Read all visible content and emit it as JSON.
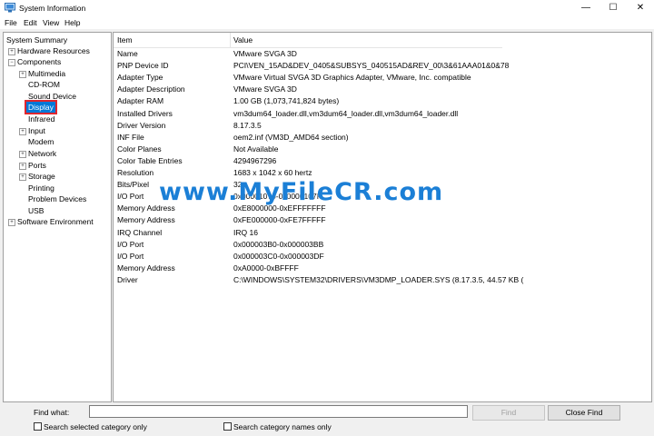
{
  "window": {
    "title": "System Information",
    "minimize_glyph": "—",
    "maximize_glyph": "☐",
    "close_glyph": "✕"
  },
  "menu": [
    "File",
    "Edit",
    "View",
    "Help"
  ],
  "tree": {
    "root": "System Summary",
    "hardware": "Hardware Resources",
    "components": "Components",
    "children": {
      "multimedia": "Multimedia",
      "cdrom": "CD-ROM",
      "sound": "Sound Device",
      "display": "Display",
      "infrared": "Infrared",
      "input": "Input",
      "modem": "Modem",
      "network": "Network",
      "ports": "Ports",
      "storage": "Storage",
      "printing": "Printing",
      "problem": "Problem Devices",
      "usb": "USB"
    },
    "software": "Software Environment",
    "expand_glyph": "+",
    "collapse_glyph": "−"
  },
  "table": {
    "col_item": "Item",
    "col_value": "Value",
    "rows": [
      {
        "item": "Name",
        "value": "VMware SVGA 3D"
      },
      {
        "item": "PNP Device ID",
        "value": "PCI\\VEN_15AD&DEV_0405&SUBSYS_040515AD&REV_00\\3&61AAA01&0&78"
      },
      {
        "item": "Adapter Type",
        "value": "VMware Virtual SVGA 3D Graphics Adapter, VMware, Inc. compatible"
      },
      {
        "item": "Adapter Description",
        "value": "VMware SVGA 3D"
      },
      {
        "item": "Adapter RAM",
        "value": "1.00 GB (1,073,741,824 bytes)"
      },
      {
        "item": "Installed Drivers",
        "value": "vm3dum64_loader.dll,vm3dum64_loader.dll,vm3dum64_loader.dll"
      },
      {
        "item": "Driver Version",
        "value": "8.17.3.5"
      },
      {
        "item": "INF File",
        "value": "oem2.inf (VM3D_AMD64 section)"
      },
      {
        "item": "Color Planes",
        "value": "Not Available"
      },
      {
        "item": "Color Table Entries",
        "value": "4294967296"
      },
      {
        "item": "Resolution",
        "value": "1683 x 1042 x 60 hertz"
      },
      {
        "item": "Bits/Pixel",
        "value": "32"
      },
      {
        "item": "I/O Port",
        "value": "0x00001070-0x0000107F"
      },
      {
        "item": "Memory Address",
        "value": "0xE8000000-0xEFFFFFFF"
      },
      {
        "item": "Memory Address",
        "value": "0xFE000000-0xFE7FFFFF"
      },
      {
        "item": "IRQ Channel",
        "value": "IRQ 16"
      },
      {
        "item": "I/O Port",
        "value": "0x000003B0-0x000003BB"
      },
      {
        "item": "I/O Port",
        "value": "0x000003C0-0x000003DF"
      },
      {
        "item": "Memory Address",
        "value": "0xA0000-0xBFFFF"
      },
      {
        "item": "Driver",
        "value": "C:\\WINDOWS\\SYSTEM32\\DRIVERS\\VM3DMP_LOADER.SYS (8.17.3.5, 44.57 KB ("
      }
    ]
  },
  "watermark": "www.MyFileCR.com",
  "find": {
    "label": "Find what:",
    "value": "",
    "find_button": "Find",
    "close_find_button": "Close Find",
    "check_selected": "Search selected category only",
    "check_names": "Search category names only"
  },
  "colors": {
    "selection": "#0078d7",
    "selection_outline": "#e0262e",
    "watermark": "#1b7fd6"
  }
}
